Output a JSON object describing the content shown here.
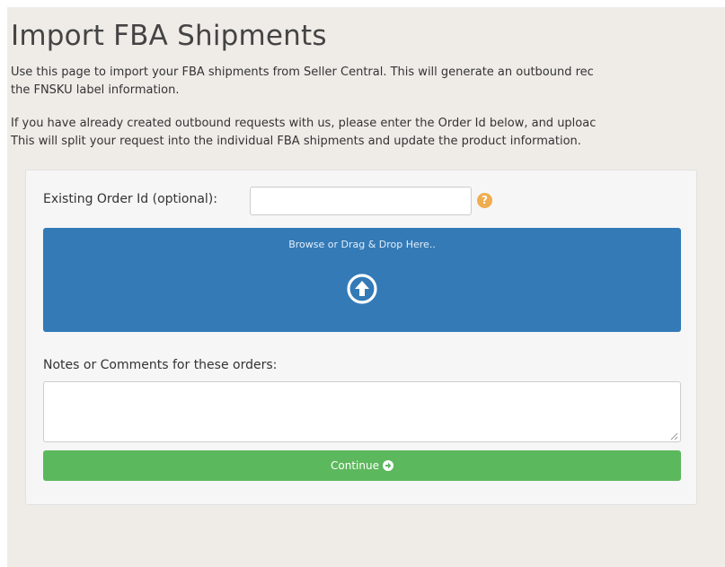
{
  "page": {
    "title": "Import FBA Shipments",
    "intro1_line1": "Use this page to import your FBA shipments from Seller Central. This will generate an outbound rec",
    "intro1_line2": "the FNSKU label information.",
    "intro2_line1": "If you have already created outbound requests with us, please enter the Order Id below, and uploac",
    "intro2_line2": "This will split your request into the individual FBA shipments and update the product information."
  },
  "form": {
    "order_id_label": "Existing Order Id (optional):",
    "order_id_value": "",
    "help_icon_glyph": "?",
    "dropzone_text": "Browse or Drag & Drop Here..",
    "dropzone_icon": "arrow-up-circle-icon",
    "notes_label": "Notes or Comments for these orders:",
    "notes_value": "",
    "continue_label": "Continue",
    "continue_icon": "arrow-right-circle-icon"
  },
  "colors": {
    "page_background": "#efece8",
    "panel_background": "#f6f6f6",
    "dropzone": "#337ab7",
    "continue_button": "#5cb85c",
    "help_icon": "#f0ad4e"
  }
}
